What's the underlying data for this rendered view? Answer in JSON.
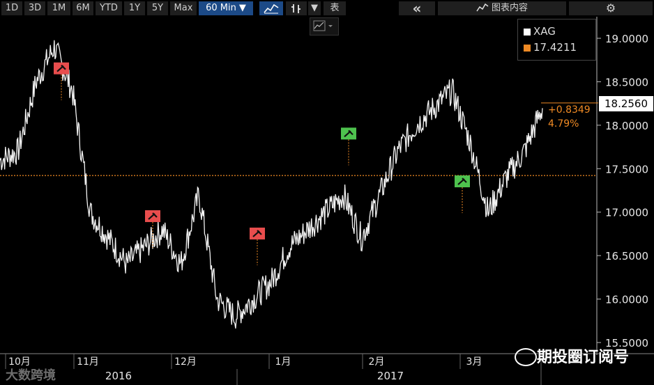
{
  "toolbar": {
    "ranges": [
      "1D",
      "3D",
      "1M",
      "6M",
      "YTD",
      "1Y",
      "5Y",
      "Max"
    ],
    "interval": "60 Min ▼",
    "table_label": "表",
    "chart_content_label": "图表内容",
    "collapse_icon": "double-chevron-left-icon",
    "settings_icon": "gear-icon"
  },
  "legend": {
    "symbol": "XAG",
    "value": "17.4211",
    "symbol_color": "#ffffff",
    "value_color": "#f08a24"
  },
  "last_price": "18.2560",
  "change_abs": "+0.8349",
  "change_pct": "4.79%",
  "watermark_left": "大数跨境",
  "watermark_right": "期投圈订阅号",
  "chart_data": {
    "type": "line",
    "series": [
      {
        "name": "XAG",
        "x": [
          "10月",
          "10月",
          "10月",
          "10月",
          "10月",
          "11月",
          "11月",
          "11月",
          "11月",
          "11月",
          "11月",
          "11月",
          "12月",
          "12月",
          "12月",
          "12月",
          "12月",
          "12月",
          "1月",
          "1月",
          "1月",
          "1月",
          "2月",
          "2月",
          "2月",
          "2月",
          "3月",
          "3月",
          "3月",
          "3月",
          "3月"
        ],
        "values": [
          17.6,
          17.7,
          18.5,
          18.9,
          18.4,
          17.0,
          16.7,
          16.4,
          16.6,
          16.8,
          16.4,
          17.2,
          16.0,
          15.8,
          16.0,
          16.2,
          16.6,
          16.8,
          17.0,
          17.2,
          16.7,
          17.2,
          17.7,
          18.0,
          18.2,
          18.4,
          17.8,
          17.0,
          17.4,
          17.7,
          18.2
        ]
      }
    ],
    "reference_line": 17.4211,
    "ylim": [
      15.5,
      19.0
    ],
    "yticks": [
      "19.0000",
      "18.5000",
      "18.0000",
      "17.5000",
      "17.0000",
      "16.5000",
      "16.0000",
      "15.5000"
    ],
    "xticks": [
      "10月",
      "11月",
      "12月",
      "1月",
      "2月",
      "3月"
    ],
    "years": [
      "2016",
      "2017"
    ],
    "grid": false,
    "legend_position": "top-right"
  }
}
